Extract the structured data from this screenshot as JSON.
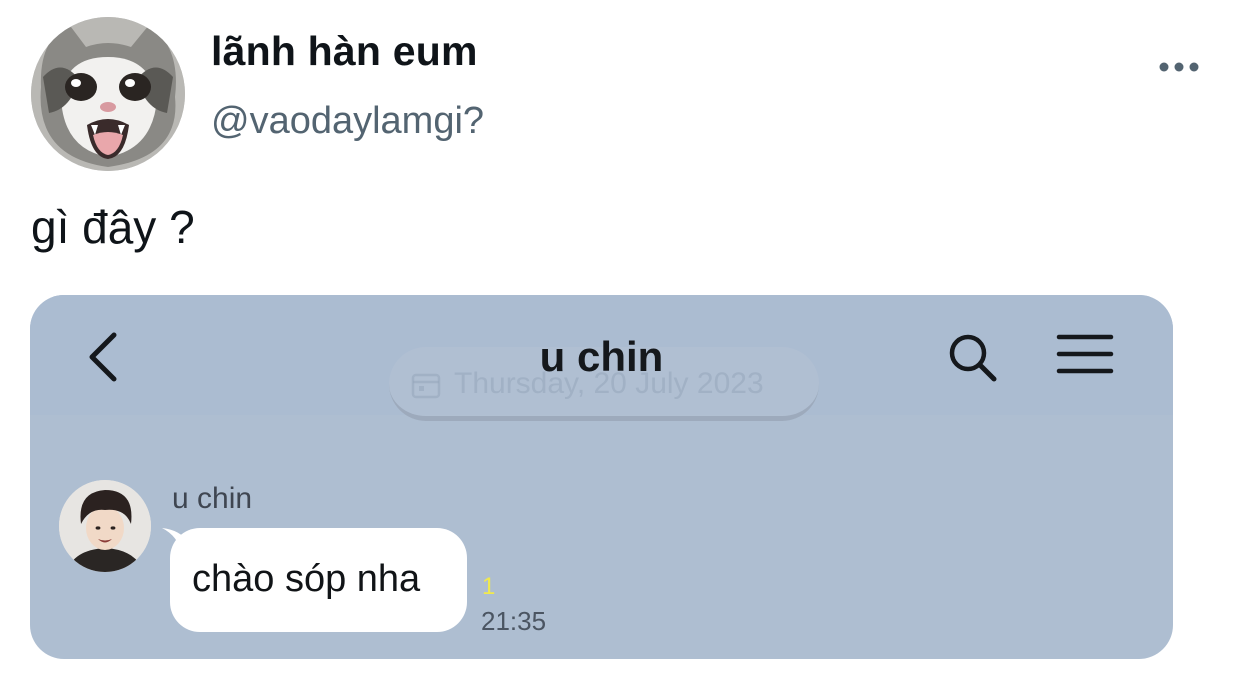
{
  "tweet": {
    "display_name": "lãnh hàn eum",
    "handle": "@vaodaylamgi?",
    "text": "gì đây ?",
    "more_icon": "more-horizontal-icon"
  },
  "chat_screenshot": {
    "title": "u chin",
    "date_label": "Thursday, 20 July 2023",
    "back_icon": "chevron-left-icon",
    "search_icon": "search-icon",
    "menu_icon": "hamburger-menu-icon",
    "background_color": "#aebed1",
    "messages": [
      {
        "sender": "u chin",
        "text": "chào sóp nha",
        "unread": "1",
        "time": "21:35"
      }
    ]
  }
}
